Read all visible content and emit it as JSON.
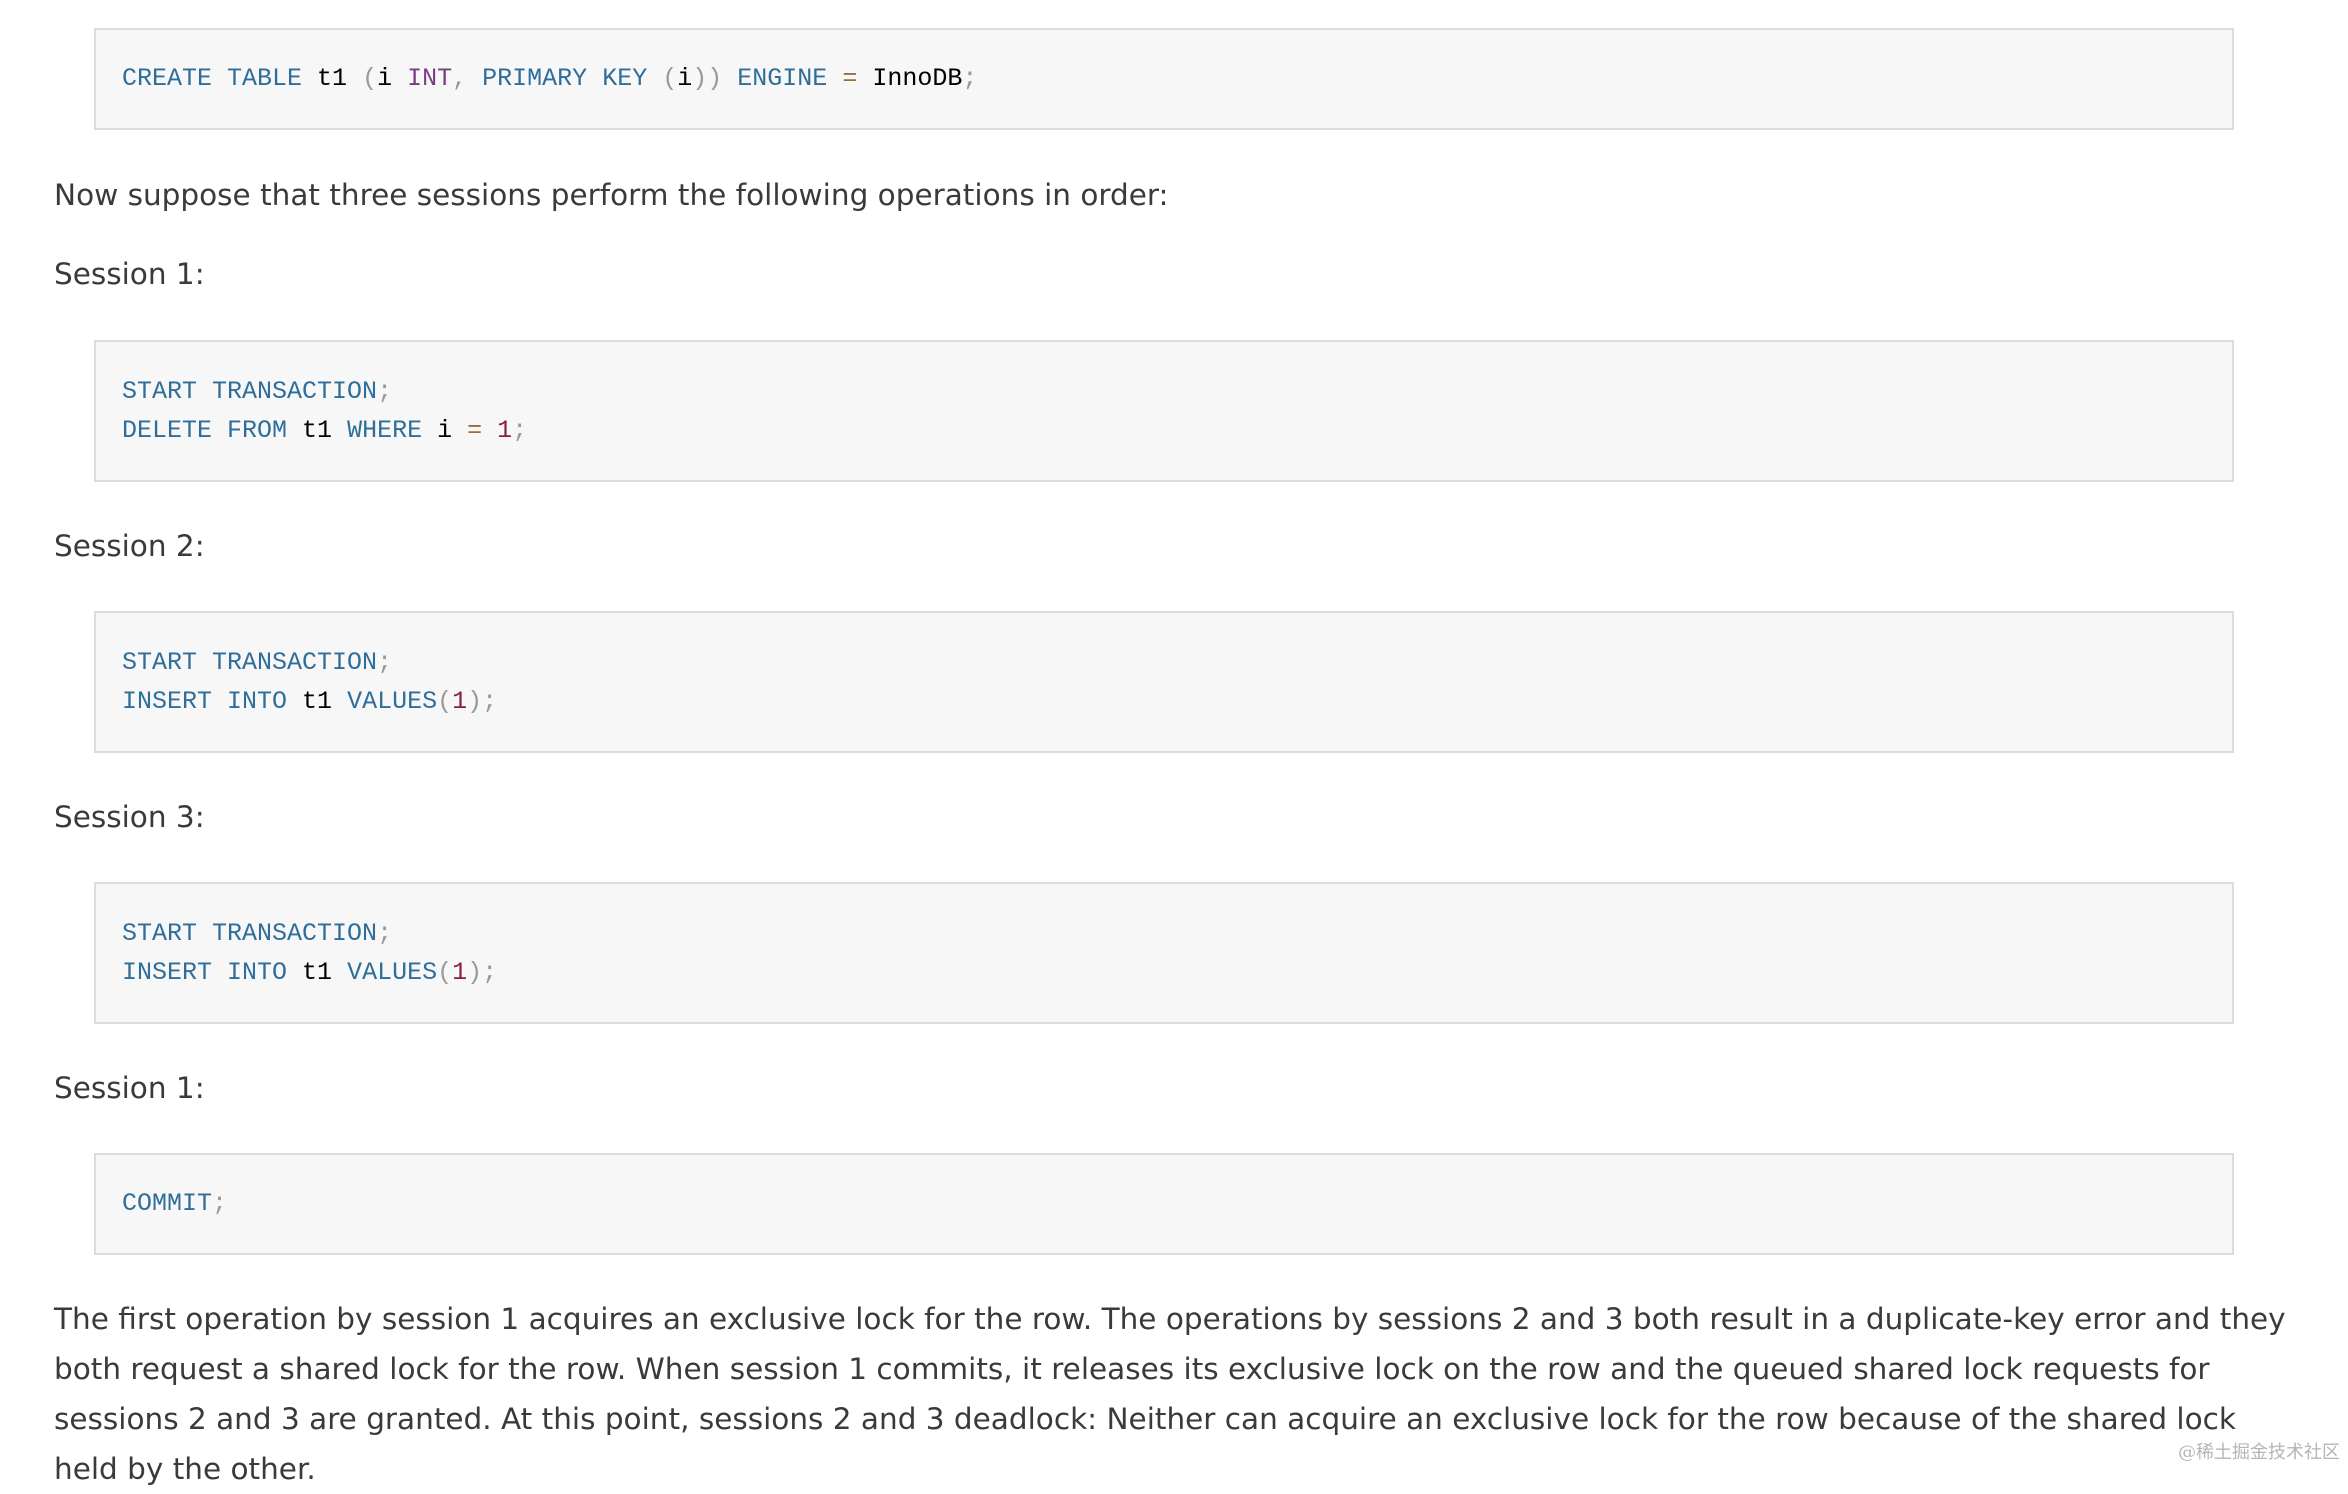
{
  "code_create": {
    "line1": [
      {
        "t": "CREATE",
        "c": "kw"
      },
      {
        "t": " ",
        "c": "id"
      },
      {
        "t": "TABLE",
        "c": "kw"
      },
      {
        "t": " t1 ",
        "c": "id"
      },
      {
        "t": "(",
        "c": "punc"
      },
      {
        "t": "i ",
        "c": "id"
      },
      {
        "t": "INT",
        "c": "type"
      },
      {
        "t": ",",
        "c": "punc"
      },
      {
        "t": " ",
        "c": "id"
      },
      {
        "t": "PRIMARY",
        "c": "kw"
      },
      {
        "t": " ",
        "c": "id"
      },
      {
        "t": "KEY",
        "c": "kw"
      },
      {
        "t": " ",
        "c": "id"
      },
      {
        "t": "(",
        "c": "punc"
      },
      {
        "t": "i",
        "c": "id"
      },
      {
        "t": "))",
        "c": "punc"
      },
      {
        "t": " ",
        "c": "id"
      },
      {
        "t": "ENGINE",
        "c": "kw"
      },
      {
        "t": " ",
        "c": "id"
      },
      {
        "t": "=",
        "c": "op"
      },
      {
        "t": " InnoDB",
        "c": "id"
      },
      {
        "t": ";",
        "c": "punc"
      }
    ]
  },
  "intro_text": "Now suppose that three sessions perform the following operations in order:",
  "session1_label": "Session 1:",
  "session2_label": "Session 2:",
  "session3_label": "Session 3:",
  "session1b_label": "Session 1:",
  "code_s1": {
    "line1": [
      {
        "t": "START",
        "c": "kw"
      },
      {
        "t": " ",
        "c": "id"
      },
      {
        "t": "TRANSACTION",
        "c": "kw"
      },
      {
        "t": ";",
        "c": "punc"
      }
    ],
    "line2": [
      {
        "t": "DELETE",
        "c": "kw"
      },
      {
        "t": " ",
        "c": "id"
      },
      {
        "t": "FROM",
        "c": "kw"
      },
      {
        "t": " t1 ",
        "c": "id"
      },
      {
        "t": "WHERE",
        "c": "kw"
      },
      {
        "t": " i ",
        "c": "id"
      },
      {
        "t": "=",
        "c": "op"
      },
      {
        "t": " ",
        "c": "id"
      },
      {
        "t": "1",
        "c": "num"
      },
      {
        "t": ";",
        "c": "punc"
      }
    ]
  },
  "code_s2": {
    "line1": [
      {
        "t": "START",
        "c": "kw"
      },
      {
        "t": " ",
        "c": "id"
      },
      {
        "t": "TRANSACTION",
        "c": "kw"
      },
      {
        "t": ";",
        "c": "punc"
      }
    ],
    "line2": [
      {
        "t": "INSERT",
        "c": "kw"
      },
      {
        "t": " ",
        "c": "id"
      },
      {
        "t": "INTO",
        "c": "kw"
      },
      {
        "t": " t1 ",
        "c": "id"
      },
      {
        "t": "VALUES",
        "c": "kw"
      },
      {
        "t": "(",
        "c": "punc"
      },
      {
        "t": "1",
        "c": "num"
      },
      {
        "t": ");",
        "c": "punc"
      }
    ]
  },
  "code_s3": {
    "line1": [
      {
        "t": "START",
        "c": "kw"
      },
      {
        "t": " ",
        "c": "id"
      },
      {
        "t": "TRANSACTION",
        "c": "kw"
      },
      {
        "t": ";",
        "c": "punc"
      }
    ],
    "line2": [
      {
        "t": "INSERT",
        "c": "kw"
      },
      {
        "t": " ",
        "c": "id"
      },
      {
        "t": "INTO",
        "c": "kw"
      },
      {
        "t": " t1 ",
        "c": "id"
      },
      {
        "t": "VALUES",
        "c": "kw"
      },
      {
        "t": "(",
        "c": "punc"
      },
      {
        "t": "1",
        "c": "num"
      },
      {
        "t": ");",
        "c": "punc"
      }
    ]
  },
  "code_commit": {
    "line1": [
      {
        "t": "COMMIT",
        "c": "kw"
      },
      {
        "t": ";",
        "c": "punc"
      }
    ]
  },
  "final_paragraph": "The first operation by session 1 acquires an exclusive lock for the row. The operations by sessions 2 and 3 both result in a duplicate-key error and they both request a shared lock for the row. When session 1 commits, it releases its exclusive lock on the row and the queued shared lock requests for sessions 2 and 3 are granted. At this point, sessions 2 and 3 deadlock: Neither can acquire an exclusive lock for the row because of the shared lock held by the other.",
  "watermark": "@稀土掘金技术社区"
}
